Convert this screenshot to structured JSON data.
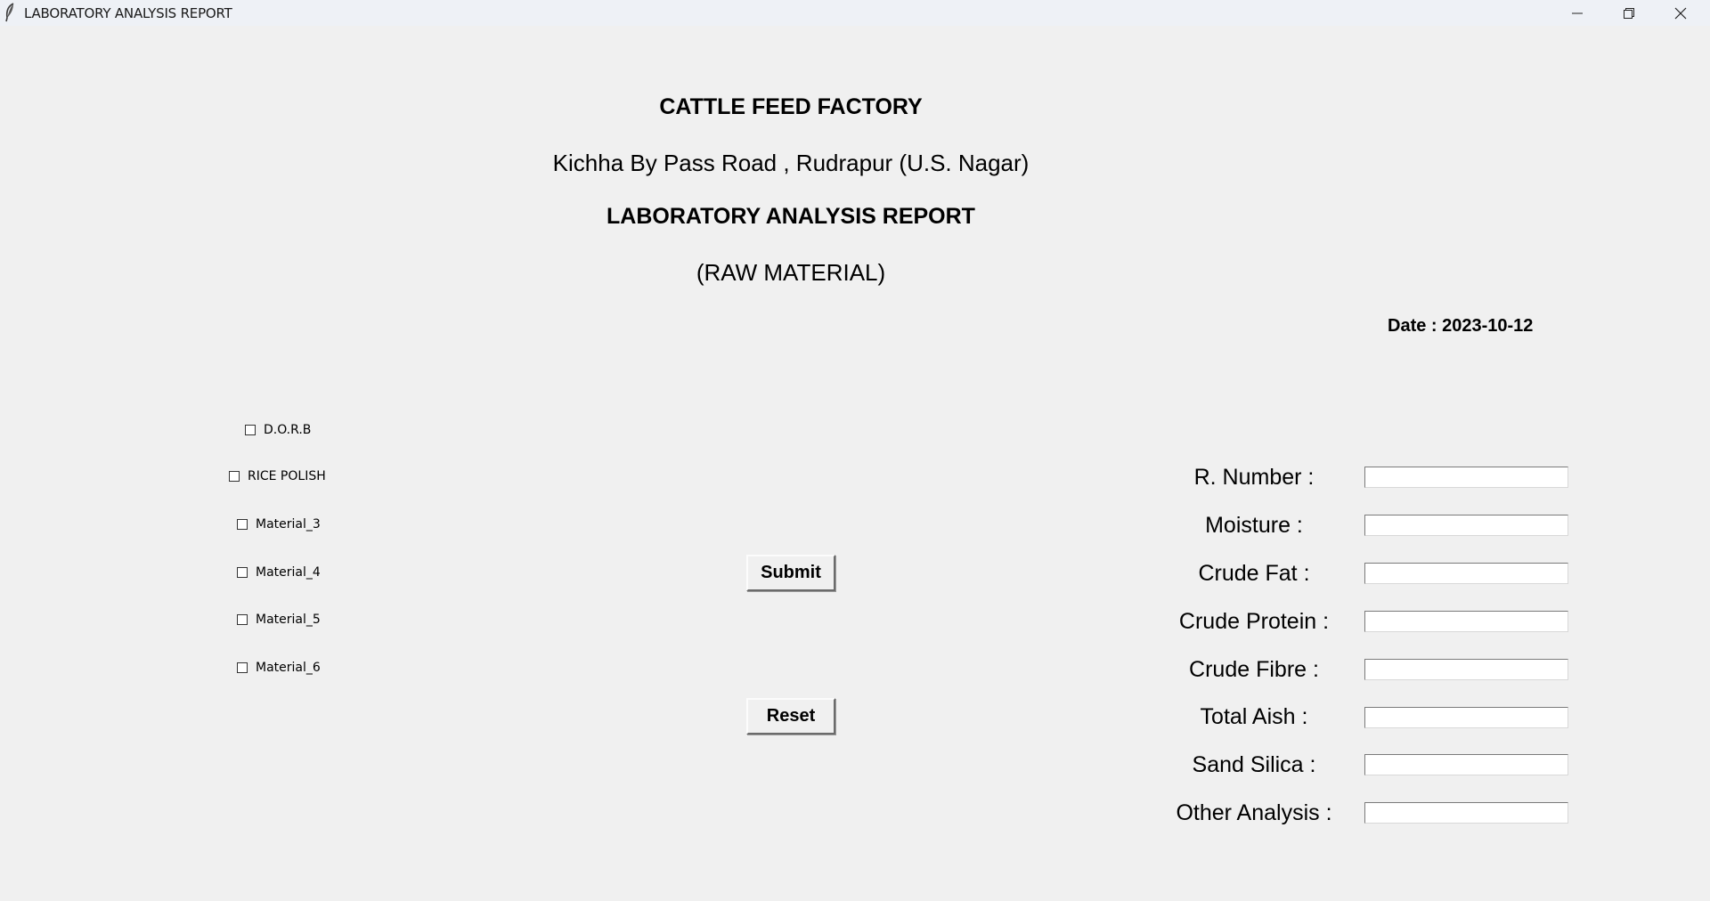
{
  "window": {
    "title": "LABORATORY ANALYSIS REPORT",
    "icon": "feather-icon",
    "controls": [
      "minimize-icon",
      "restore-icon",
      "close-icon"
    ]
  },
  "header": {
    "company": "CATTLE FEED FACTORY",
    "address": "Kichha By Pass Road , Rudrapur (U.S. Nagar)",
    "report_title": "LABORATORY ANALYSIS REPORT",
    "subtitle": "(RAW MATERIAL)",
    "date": "Date : 2023-10-12"
  },
  "materials": [
    {
      "label": "D.O.R.B",
      "checked": false
    },
    {
      "label": "RICE POLISH",
      "checked": false
    },
    {
      "label": "Material_3",
      "checked": false
    },
    {
      "label": "Material_4",
      "checked": false
    },
    {
      "label": "Material_5",
      "checked": false
    },
    {
      "label": "Material_6",
      "checked": false
    }
  ],
  "actions": {
    "submit_label": "Submit",
    "reset_label": "Reset"
  },
  "fields": [
    {
      "label": "R. Number :",
      "value": ""
    },
    {
      "label": "Moisture :",
      "value": ""
    },
    {
      "label": "Crude Fat :",
      "value": ""
    },
    {
      "label": "Crude Protein :",
      "value": ""
    },
    {
      "label": "Crude Fibre :",
      "value": ""
    },
    {
      "label": "Total Aish :",
      "value": ""
    },
    {
      "label": "Sand Silica :",
      "value": ""
    },
    {
      "label": "Other Analysis :",
      "value": ""
    }
  ]
}
